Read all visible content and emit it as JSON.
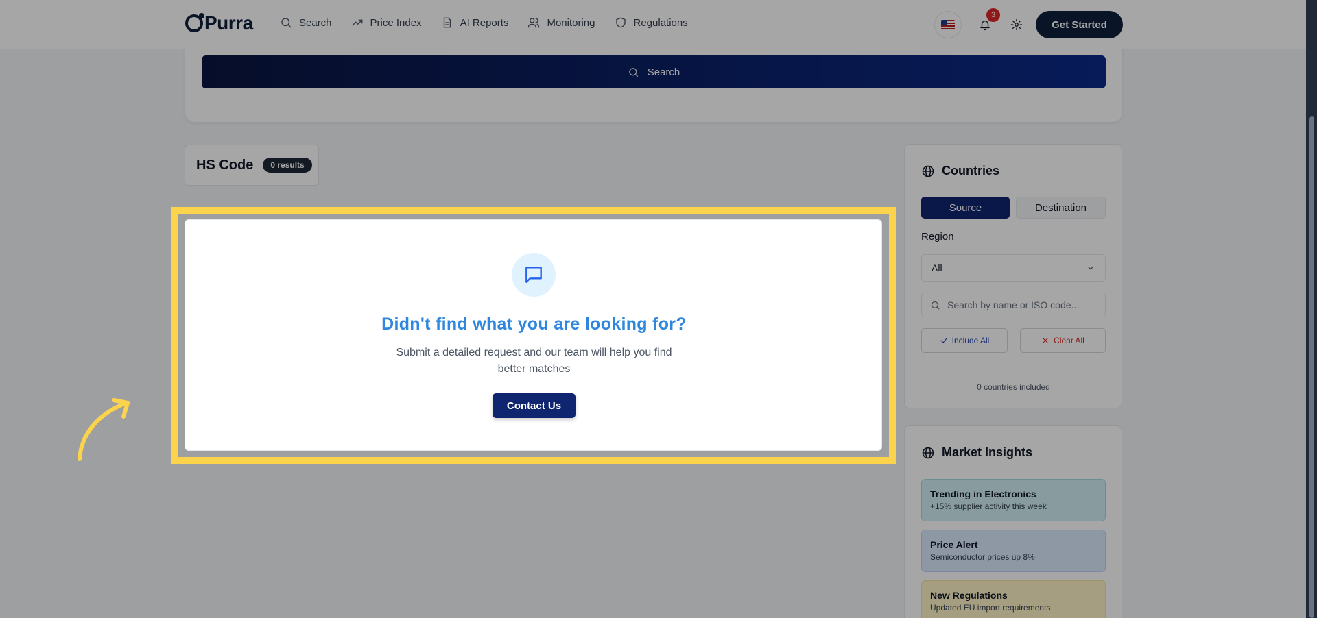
{
  "header": {
    "logo_text": "Purra",
    "nav": [
      {
        "label": "Search",
        "icon": "search-icon"
      },
      {
        "label": "Price Index",
        "icon": "trend-icon"
      },
      {
        "label": "AI Reports",
        "icon": "document-icon"
      },
      {
        "label": "Monitoring",
        "icon": "users-icon"
      },
      {
        "label": "Regulations",
        "icon": "shield-icon"
      }
    ],
    "notification_count": "3",
    "cta_label": "Get Started"
  },
  "search": {
    "button_label": "Search"
  },
  "results": {
    "title": "HS Code",
    "count_label": "0 results"
  },
  "empty_state": {
    "title": "Didn't find what you are looking for?",
    "description": "Submit a detailed request and our team will help you find better matches",
    "button_label": "Contact Us"
  },
  "countries": {
    "title": "Countries",
    "toggle": [
      "Source",
      "Destination"
    ],
    "region_label": "Region",
    "region_value": "All",
    "search_placeholder": "Search by name or ISO code...",
    "include_all": "Include All",
    "clear_all": "Clear All",
    "count_text": "0 countries included"
  },
  "insights": {
    "title": "Market Insights",
    "items": [
      {
        "title": "Trending in Electronics",
        "subtitle": "+15% supplier activity this week",
        "color": "#d1f0f5"
      },
      {
        "title": "Price Alert",
        "subtitle": "Semiconductor prices up 8%",
        "color": "#dbeafe"
      },
      {
        "title": "New Regulations",
        "subtitle": "Updated EU import requirements",
        "color": "#fef3c7"
      }
    ]
  },
  "colors": {
    "highlight": "#fcd34d",
    "primary": "#0f2570",
    "accent": "#2e86de"
  }
}
